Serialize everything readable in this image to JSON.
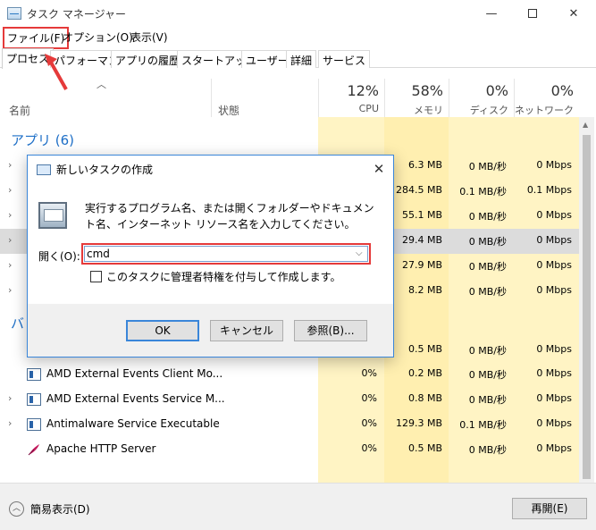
{
  "window": {
    "title": "タスク マネージャー",
    "minimize": "—",
    "close": "✕"
  },
  "menu": {
    "file": "ファイル(F)",
    "options": "オプション(O)",
    "view": "表示(V)"
  },
  "tabs": [
    "プロセス",
    "パフォーマンス",
    "アプリの履歴",
    "スタートアップ",
    "ユーザー",
    "詳細",
    "サービス"
  ],
  "columns": {
    "name": "名前",
    "status": "状態",
    "cpu_pct": "12%",
    "cpu_label": "CPU",
    "mem_pct": "58%",
    "mem_label": "メモリ",
    "disk_pct": "0%",
    "disk_label": "ディスク",
    "net_pct": "0%",
    "net_label": "ネットワーク"
  },
  "groups": {
    "apps": "アプリ (6)",
    "background_partial": "バ"
  },
  "app_rows": [
    {
      "cpu": "",
      "mem": "6.3 MB",
      "disk": "0 MB/秒",
      "net": "0 Mbps"
    },
    {
      "cpu": "",
      "mem": "284.5 MB",
      "disk": "0.1 MB/秒",
      "net": "0.1 Mbps"
    },
    {
      "cpu": "",
      "mem": "55.1 MB",
      "disk": "0 MB/秒",
      "net": "0 Mbps"
    },
    {
      "cpu": "",
      "mem": "29.4 MB",
      "disk": "0 MB/秒",
      "net": "0 Mbps"
    },
    {
      "cpu": "",
      "mem": "27.9 MB",
      "disk": "0 MB/秒",
      "net": "0 Mbps"
    },
    {
      "cpu": "",
      "mem": "8.2 MB",
      "disk": "0 MB/秒",
      "net": "0 Mbps"
    }
  ],
  "bg_rows": [
    {
      "name": "",
      "cpu": "",
      "mem": "0.5 MB",
      "disk": "0 MB/秒",
      "net": "0 Mbps"
    },
    {
      "name": "AMD External Events Client Mo...",
      "cpu": "0%",
      "mem": "0.2 MB",
      "disk": "0 MB/秒",
      "net": "0 Mbps"
    },
    {
      "name": "AMD External Events Service M...",
      "cpu": "0%",
      "mem": "0.8 MB",
      "disk": "0 MB/秒",
      "net": "0 Mbps"
    },
    {
      "name": "Antimalware Service Executable",
      "cpu": "0%",
      "mem": "129.3 MB",
      "disk": "0.1 MB/秒",
      "net": "0 Mbps"
    },
    {
      "name": "Apache HTTP Server",
      "cpu": "0%",
      "mem": "0.5 MB",
      "disk": "0 MB/秒",
      "net": "0 Mbps"
    }
  ],
  "bottom": {
    "fewer_details": "簡易表示(D)",
    "restart": "再開(E)"
  },
  "dialog": {
    "title": "新しいタスクの作成",
    "description": "実行するプログラム名、または開くフォルダーやドキュメント名、インターネット リソース名を入力してください。",
    "open_label": "開く(O):",
    "input_value": "cmd",
    "admin_label": "このタスクに管理者特権を付与して作成します。",
    "ok": "OK",
    "cancel": "キャンセル",
    "browse": "参照(B)...",
    "close": "✕"
  },
  "colors": {
    "highlight_red": "#e53a3a",
    "group_blue": "#1e6fc7",
    "metric_bg": "#fff4c4",
    "dialog_border": "#3a86d9"
  }
}
